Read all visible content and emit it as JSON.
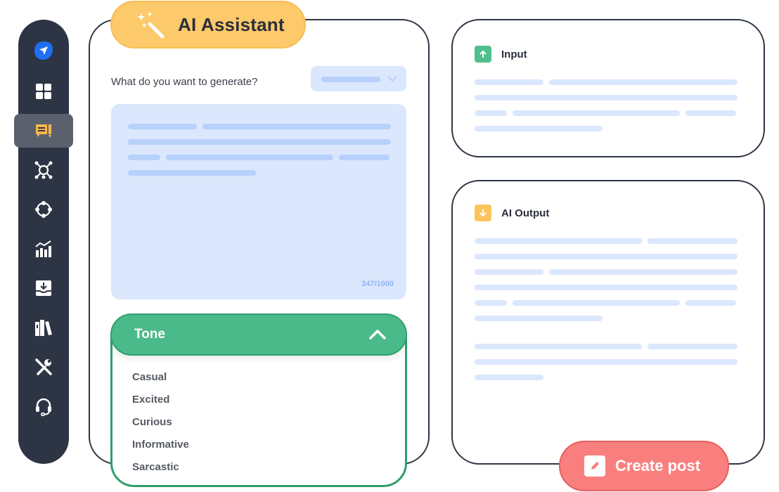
{
  "sidebar": {
    "items": [
      {
        "icon": "send-icon",
        "active": false
      },
      {
        "icon": "dashboard-icon",
        "active": false
      },
      {
        "icon": "ai-compose-icon",
        "active": true
      },
      {
        "icon": "network-icon",
        "active": false
      },
      {
        "icon": "connections-icon",
        "active": false
      },
      {
        "icon": "analytics-icon",
        "active": false
      },
      {
        "icon": "inbox-download-icon",
        "active": false
      },
      {
        "icon": "library-icon",
        "active": false
      },
      {
        "icon": "tools-icon",
        "active": false
      },
      {
        "icon": "support-headset-icon",
        "active": false
      }
    ]
  },
  "assistant": {
    "title": "AI Assistant",
    "generate_label": "What do you want to generate?",
    "char_count": "347/1000",
    "tone": {
      "label": "Tone",
      "options": [
        "Casual",
        "Excited",
        "Curious",
        "Informative",
        "Sarcastic"
      ]
    }
  },
  "input_card": {
    "title": "Input"
  },
  "output_card": {
    "title": "AI Output"
  },
  "create_button": {
    "label": "Create post"
  },
  "colors": {
    "sidebar_bg": "#2d3544",
    "accent_yellow": "#fcc96b",
    "tone_green": "#4bba8a",
    "create_red": "#f97f7f",
    "skeleton_blue": "#dbe7fd"
  }
}
